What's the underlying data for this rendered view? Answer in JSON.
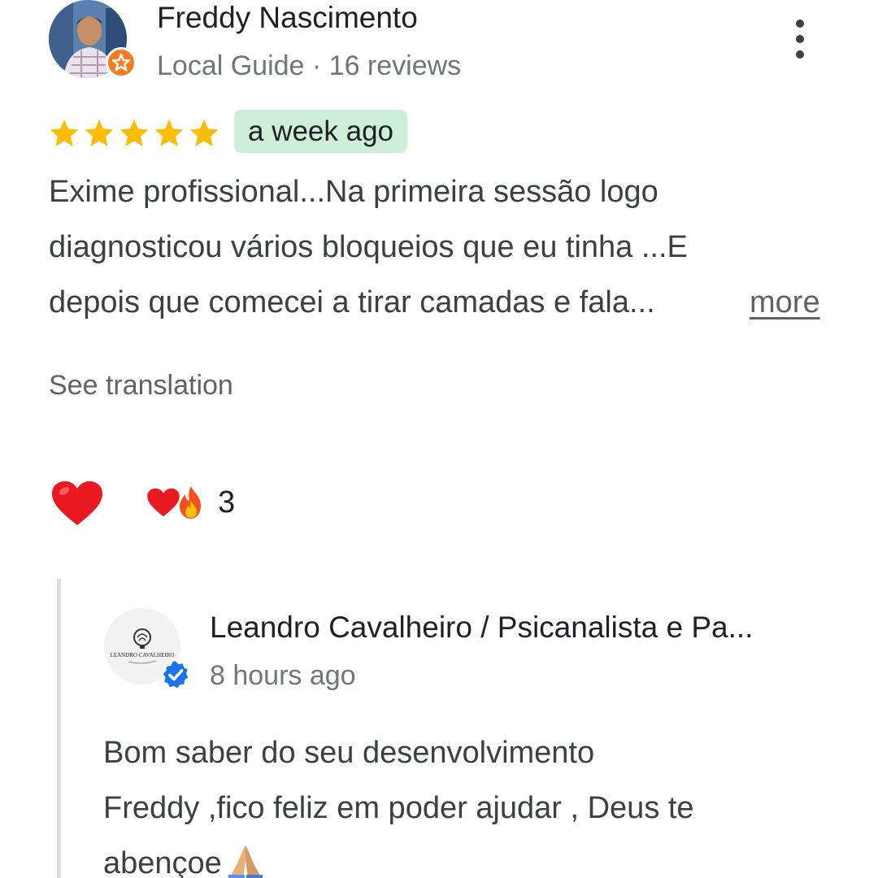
{
  "review": {
    "reviewer_name": "Freddy Nascimento",
    "reviewer_meta": "Local Guide · 16 reviews",
    "avatar_icon": "user-photo",
    "badge_icon": "local-guide-star-icon",
    "menu_icon": "more-vert-icon",
    "rating": 5,
    "rating_max": 5,
    "time": "a week ago",
    "text_lines": [
      "Exime profissional...Na primeira sessão logo",
      "diagnosticou vários bloqueios que eu tinha ...E",
      "depois que comecei a tirar camadas e fala..."
    ],
    "more_label": "more",
    "translation_label": "See translation",
    "colors": {
      "star": "#fbbc04",
      "time_chip": "#cdefd7",
      "guide_badge": "#f57c21"
    }
  },
  "reactions": {
    "react_icon": "heart-icon",
    "summary_icons": [
      "heart-icon",
      "fire-icon"
    ],
    "count": "3"
  },
  "reply": {
    "owner_name": "Leandro Cavalheiro / Psicanalista e Pa...",
    "time": "8 hours ago",
    "avatar_icon": "business-logo",
    "avatar_logo_text": "LEANDRO CAVALHEIRO",
    "verified_icon": "verified-check-icon",
    "text_lines": [
      "Bom saber do seu desenvolvimento",
      "Freddy ,fico feliz em poder ajudar , Deus te",
      "abençoe"
    ],
    "trailing_icon": "folded-hands-icon"
  }
}
